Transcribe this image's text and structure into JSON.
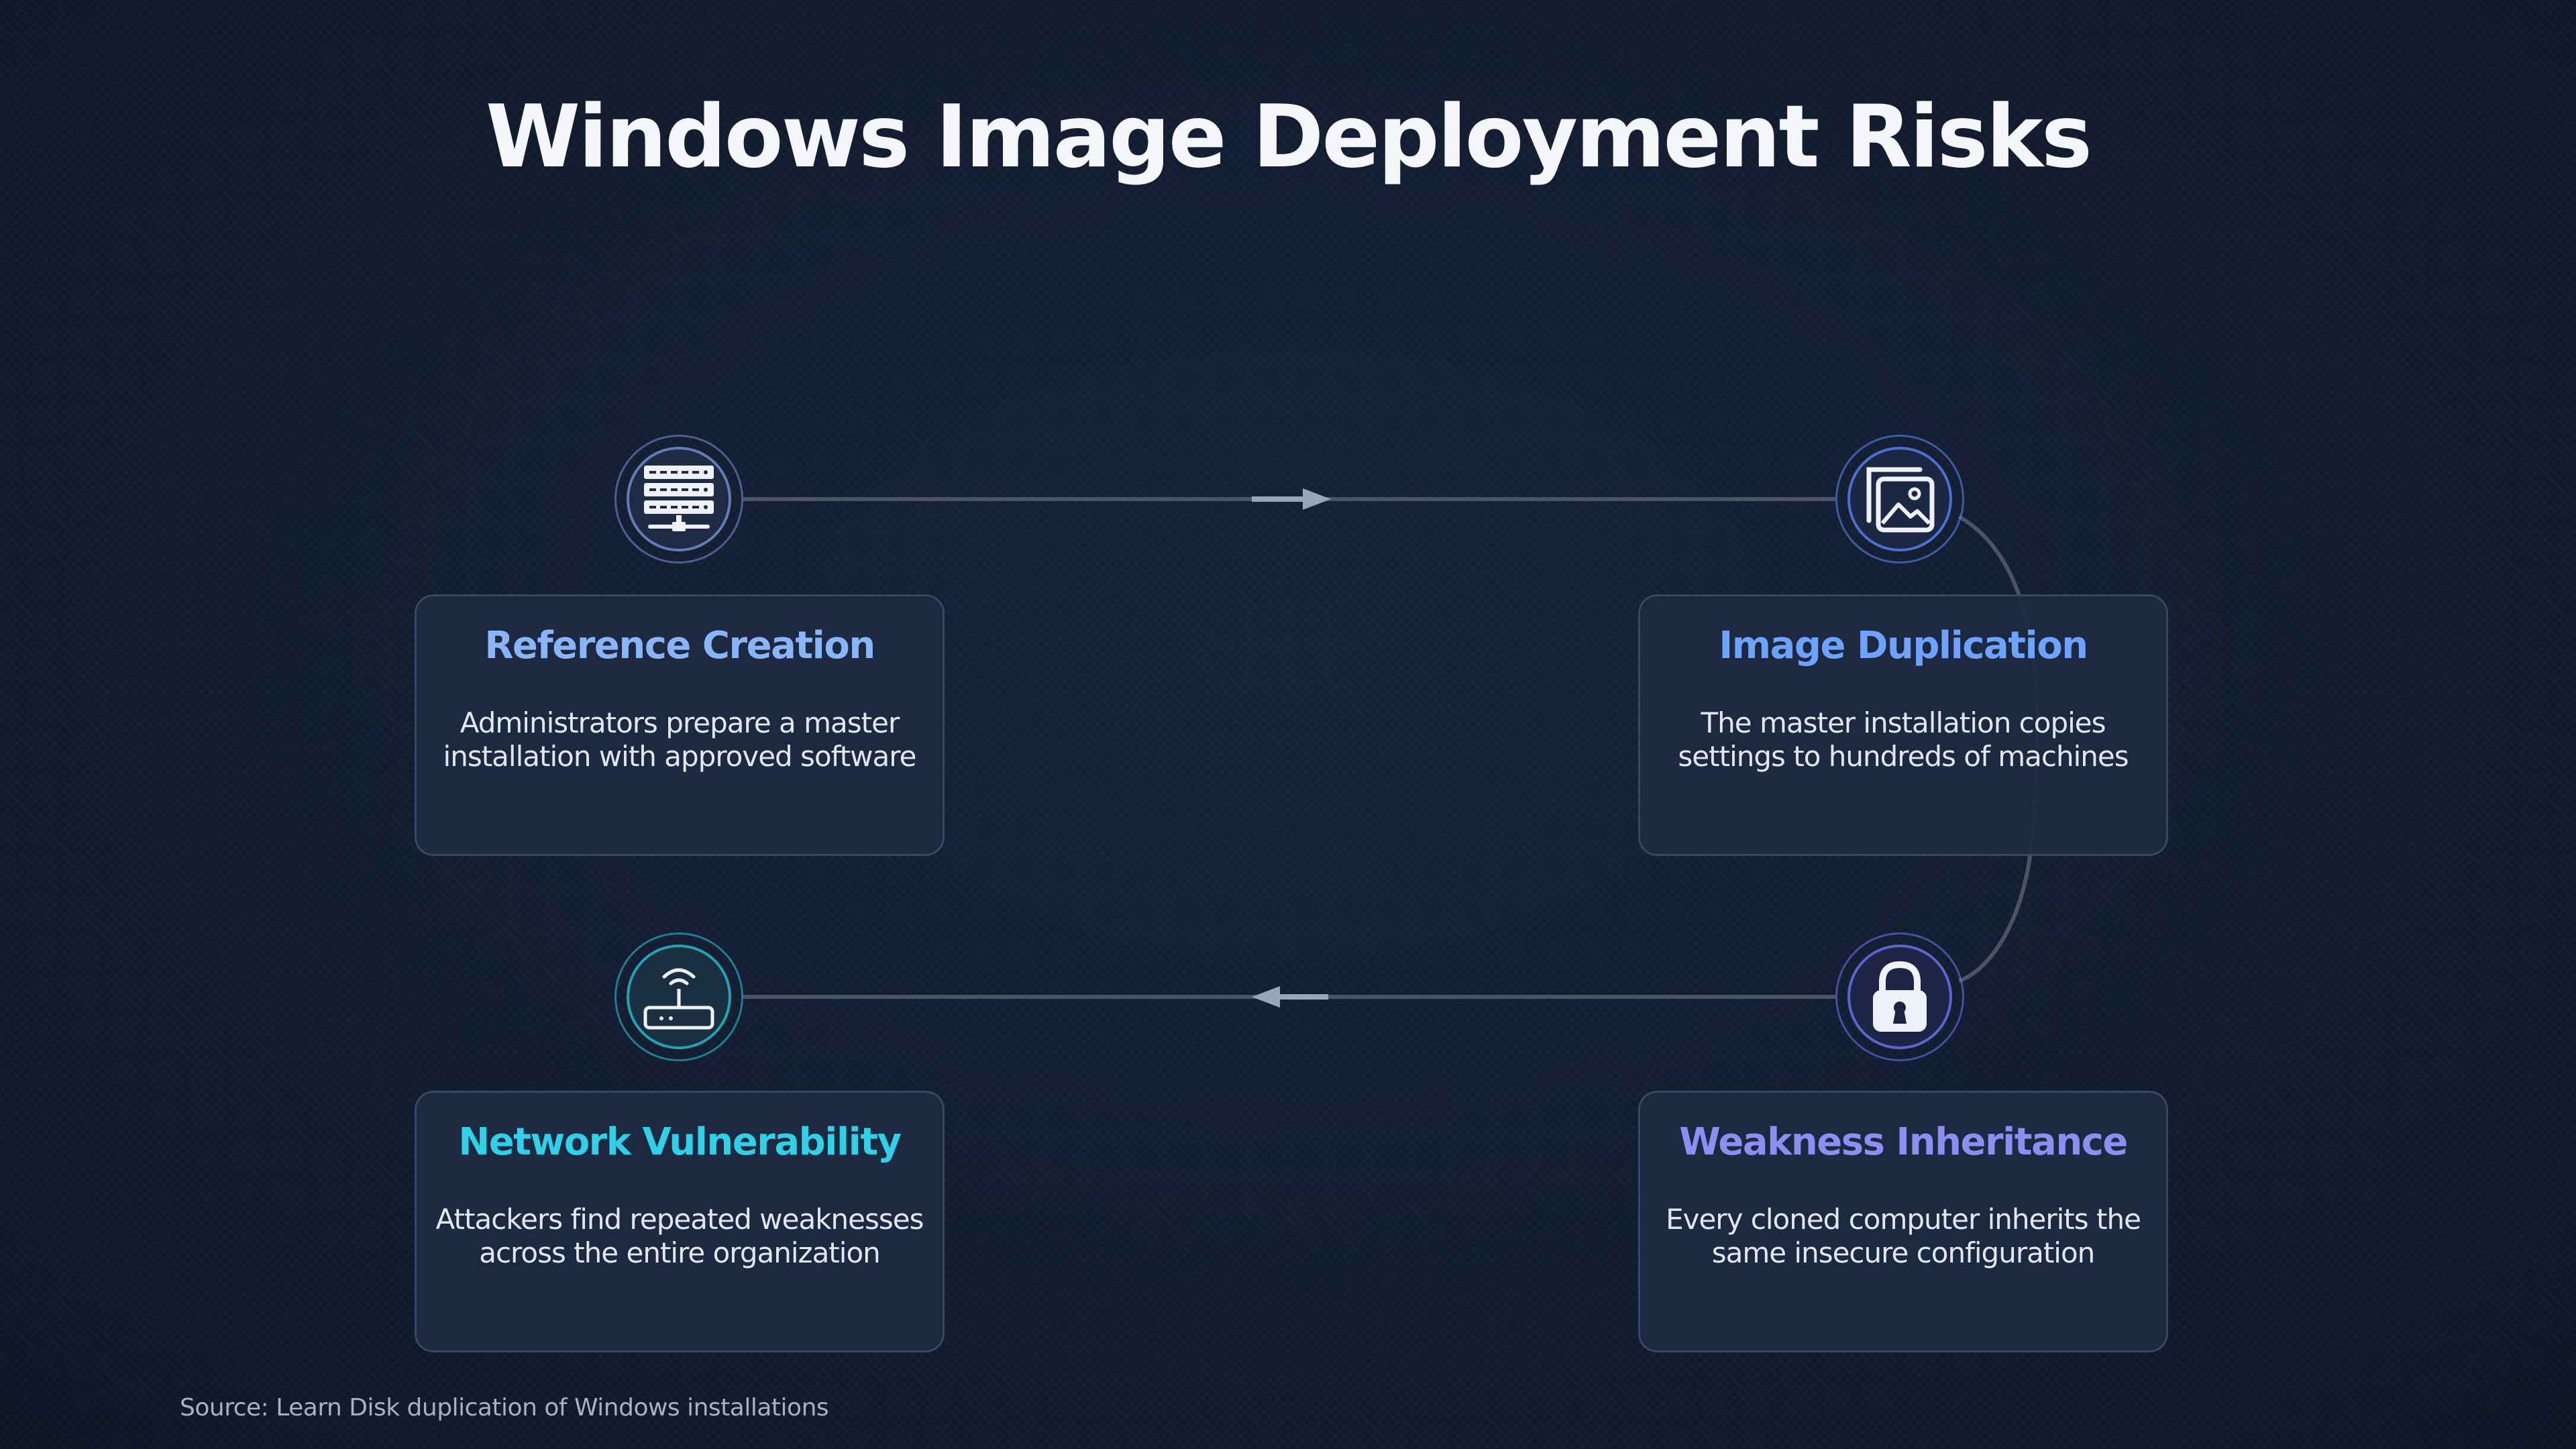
{
  "title": "Windows Image Deployment Risks",
  "steps": [
    {
      "title": "Reference Creation",
      "description": "Administrators prepare a master installation with approved software",
      "icon": "server-rack-icon",
      "accent": "#8ab4f8"
    },
    {
      "title": "Image Duplication",
      "description": "The master installation copies settings to hundreds of machines",
      "icon": "image-copies-icon",
      "accent": "#6ea2ff"
    },
    {
      "title": "Weakness Inheritance",
      "description": "Every cloned computer inherits the same insecure configuration",
      "icon": "padlock-icon",
      "accent": "#8f8cf2"
    },
    {
      "title": "Network Vulnerability",
      "description": "Attackers find repeated weaknesses across the entire organization",
      "icon": "wifi-router-icon",
      "accent": "#2fd0e8"
    }
  ],
  "source": "Source: Learn Disk duplication of Windows installations",
  "colors": {
    "background": "#131d31",
    "connector": "#4a5568",
    "arrow": "#a0aec0"
  }
}
